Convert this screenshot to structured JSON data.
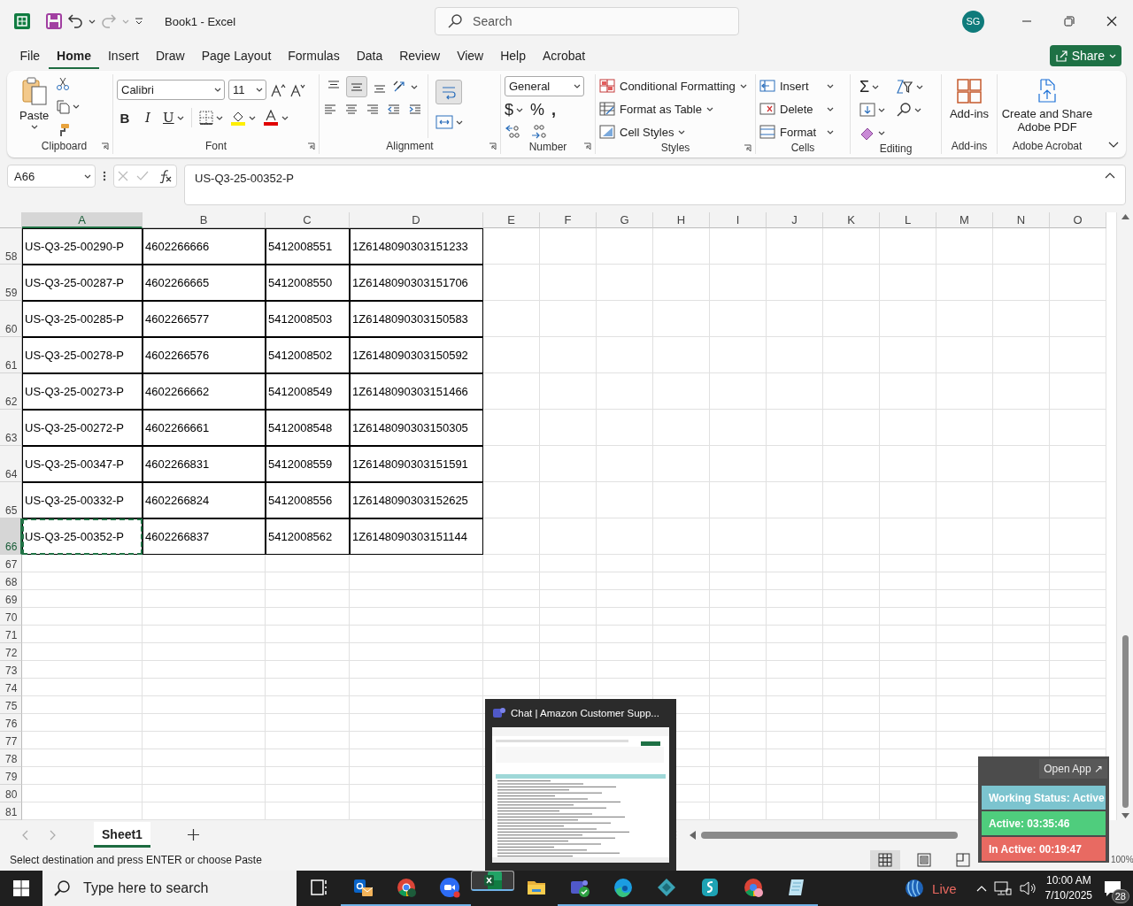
{
  "title_bar": {
    "title": "Book1  -  Excel",
    "search_placeholder": "Search",
    "avatar": "SG"
  },
  "menu_tabs": [
    {
      "label": "File",
      "selected": false
    },
    {
      "label": "Home",
      "selected": true
    },
    {
      "label": "Insert",
      "selected": false
    },
    {
      "label": "Draw",
      "selected": false
    },
    {
      "label": "Page Layout",
      "selected": false
    },
    {
      "label": "Formulas",
      "selected": false
    },
    {
      "label": "Data",
      "selected": false
    },
    {
      "label": "Review",
      "selected": false
    },
    {
      "label": "View",
      "selected": false
    },
    {
      "label": "Help",
      "selected": false
    },
    {
      "label": "Acrobat",
      "selected": false
    }
  ],
  "share_button": "Share",
  "ribbon": [
    {
      "kind": "clipboard",
      "label": "Clipboard",
      "launcher": true,
      "paste": "Paste"
    },
    {
      "kind": "font",
      "label": "Font",
      "launcher": true,
      "font_name": "Calibri",
      "font_size": "11",
      "bold": "B",
      "italic": "I",
      "underline": "U"
    },
    {
      "kind": "alignment",
      "label": "Alignment",
      "launcher": true,
      "vertical_align": [
        {
          "selected": false
        },
        {
          "selected": true
        },
        {
          "selected": false
        }
      ],
      "wrap_text": {
        "selected": true
      }
    },
    {
      "kind": "number",
      "label": "Number",
      "launcher": true,
      "format": "General",
      "symbols": [
        "$",
        "%",
        ","
      ]
    },
    {
      "kind": "styles",
      "label": "Styles",
      "launcher": true,
      "items": [
        "Conditional Formatting",
        "Format as Table",
        "Cell Styles"
      ]
    },
    {
      "kind": "cells",
      "label": "Cells",
      "launcher": false,
      "items": [
        "Insert",
        "Delete",
        "Format"
      ]
    },
    {
      "kind": "editing",
      "label": "Editing",
      "launcher": false,
      "sum": "Σ"
    },
    {
      "kind": "addins",
      "label": "Add-ins",
      "launcher": false,
      "button": "Add-ins"
    },
    {
      "kind": "acrobat",
      "label": "Adobe Acrobat",
      "launcher": false,
      "button": "Create and Share Adobe PDF"
    }
  ],
  "formula_bar": {
    "name_box": "A66",
    "value": "US-Q3-25-00352-P"
  },
  "sheet": {
    "columns": [
      {
        "label": "A",
        "selected": true
      },
      {
        "label": "B",
        "selected": false
      },
      {
        "label": "C",
        "selected": false
      },
      {
        "label": "D",
        "selected": false
      },
      {
        "label": "E",
        "selected": false
      },
      {
        "label": "F",
        "selected": false
      },
      {
        "label": "G",
        "selected": false
      },
      {
        "label": "H",
        "selected": false
      },
      {
        "label": "I",
        "selected": false
      },
      {
        "label": "J",
        "selected": false
      },
      {
        "label": "K",
        "selected": false
      },
      {
        "label": "L",
        "selected": false
      },
      {
        "label": "M",
        "selected": false
      },
      {
        "label": "N",
        "selected": false
      },
      {
        "label": "O",
        "selected": false
      }
    ],
    "rows": [
      {
        "number": "58",
        "selected": false,
        "cells": [
          {
            "text": "US-Q3-25-00290-P",
            "selected": false
          },
          {
            "text": "4602266666",
            "selected": false
          },
          {
            "text": "5412008551",
            "selected": false
          },
          {
            "text": "1Z6148090303151233",
            "selected": false
          }
        ]
      },
      {
        "number": "59",
        "selected": false,
        "cells": [
          {
            "text": "US-Q3-25-00287-P",
            "selected": false
          },
          {
            "text": "4602266665",
            "selected": false
          },
          {
            "text": "5412008550",
            "selected": false
          },
          {
            "text": "1Z6148090303151706",
            "selected": false
          }
        ]
      },
      {
        "number": "60",
        "selected": false,
        "cells": [
          {
            "text": "US-Q3-25-00285-P",
            "selected": false
          },
          {
            "text": "4602266577",
            "selected": false
          },
          {
            "text": "5412008503",
            "selected": false
          },
          {
            "text": "1Z6148090303150583",
            "selected": false
          }
        ]
      },
      {
        "number": "61",
        "selected": false,
        "cells": [
          {
            "text": "US-Q3-25-00278-P",
            "selected": false
          },
          {
            "text": "4602266576",
            "selected": false
          },
          {
            "text": "5412008502",
            "selected": false
          },
          {
            "text": "1Z6148090303150592",
            "selected": false
          }
        ]
      },
      {
        "number": "62",
        "selected": false,
        "cells": [
          {
            "text": "US-Q3-25-00273-P",
            "selected": false
          },
          {
            "text": "4602266662",
            "selected": false
          },
          {
            "text": "5412008549",
            "selected": false
          },
          {
            "text": "1Z6148090303151466",
            "selected": false
          }
        ]
      },
      {
        "number": "63",
        "selected": false,
        "cells": [
          {
            "text": "US-Q3-25-00272-P",
            "selected": false
          },
          {
            "text": "4602266661",
            "selected": false
          },
          {
            "text": "5412008548",
            "selected": false
          },
          {
            "text": "1Z6148090303150305",
            "selected": false
          }
        ]
      },
      {
        "number": "64",
        "selected": false,
        "cells": [
          {
            "text": "US-Q3-25-00347-P",
            "selected": false
          },
          {
            "text": "4602266831",
            "selected": false
          },
          {
            "text": "5412008559",
            "selected": false
          },
          {
            "text": "1Z6148090303151591",
            "selected": false
          }
        ]
      },
      {
        "number": "65",
        "selected": false,
        "cells": [
          {
            "text": "US-Q3-25-00332-P",
            "selected": false
          },
          {
            "text": "4602266824",
            "selected": false
          },
          {
            "text": "5412008556",
            "selected": false
          },
          {
            "text": "1Z6148090303152625",
            "selected": false
          }
        ]
      },
      {
        "number": "66",
        "selected": true,
        "cells": [
          {
            "text": "US-Q3-25-00352-P",
            "selected": true
          },
          {
            "text": "4602266837",
            "selected": false
          },
          {
            "text": "5412008562",
            "selected": false
          },
          {
            "text": "1Z6148090303151144",
            "selected": false
          }
        ]
      },
      {
        "number": "67",
        "selected": false
      },
      {
        "number": "68",
        "selected": false
      },
      {
        "number": "69",
        "selected": false
      },
      {
        "number": "70",
        "selected": false
      },
      {
        "number": "71",
        "selected": false
      },
      {
        "number": "72",
        "selected": false
      },
      {
        "number": "73",
        "selected": false
      },
      {
        "number": "74",
        "selected": false
      },
      {
        "number": "75",
        "selected": false
      },
      {
        "number": "76",
        "selected": false
      },
      {
        "number": "77",
        "selected": false
      },
      {
        "number": "78",
        "selected": false
      },
      {
        "number": "79",
        "selected": false
      },
      {
        "number": "80",
        "selected": false
      },
      {
        "number": "81",
        "selected": false
      }
    ]
  },
  "sheet_tabs": [
    {
      "label": "Sheet1",
      "selected": true
    }
  ],
  "status_bar": {
    "message": "Select destination and press ENTER or choose Paste",
    "view_modes": [
      {
        "selected": true
      },
      {
        "selected": false
      },
      {
        "selected": false
      }
    ],
    "zoom": "100%"
  },
  "preview_popup": {
    "title": "Chat | Amazon Customer Supp..."
  },
  "status_widget": {
    "button": "Open App ↗",
    "items": [
      {
        "text": "Working Status: Active",
        "color": "#7cc4cf"
      },
      {
        "text": "Active: 03:35:46",
        "color": "#4fcd7d"
      },
      {
        "text": "In Active: 00:19:47",
        "color": "#e86a62"
      }
    ]
  },
  "taskbar": {
    "search_placeholder": "Type here to search",
    "apps": [
      {
        "kind": "task-view",
        "running": false,
        "selected": false
      },
      {
        "kind": "mail",
        "running": true,
        "selected": false
      },
      {
        "kind": "browser",
        "running": true,
        "selected": false
      },
      {
        "kind": "video",
        "running": true,
        "selected": false
      },
      {
        "kind": "spreadsheet",
        "running": true,
        "selected": true
      },
      {
        "kind": "folder",
        "running": false,
        "selected": false
      },
      {
        "kind": "chat",
        "running": true,
        "selected": false
      },
      {
        "kind": "edge",
        "running": true,
        "selected": false
      },
      {
        "kind": "diamond",
        "running": true,
        "selected": false
      },
      {
        "kind": "vpn",
        "running": true,
        "selected": false
      },
      {
        "kind": "browser-profile",
        "running": true,
        "selected": false
      },
      {
        "kind": "notes",
        "running": true,
        "selected": false
      }
    ],
    "weather": "Live",
    "time": "10:00 AM",
    "date": "7/10/2025",
    "notifications": "28"
  }
}
